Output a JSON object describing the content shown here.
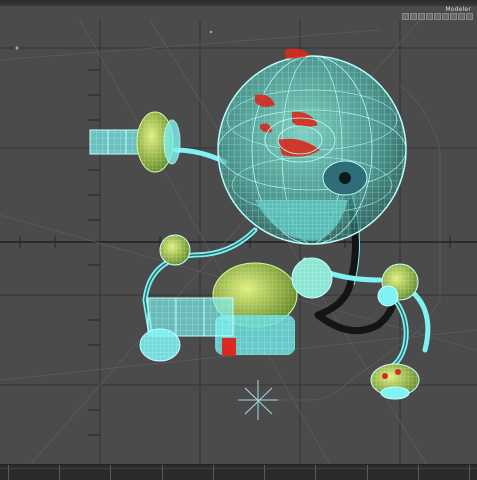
{
  "window": {
    "mode_label": "Modeler"
  },
  "toolbar": {
    "mode_button_count": 9
  },
  "viewport": {
    "background": "#4b4b4b",
    "grid_color": "#2f2f2f",
    "wire_color": "#7ff3f3",
    "accent_green": "#c9e24a",
    "accent_red": "#d82a1e",
    "dark_pipe": "#151515"
  },
  "timeline": {
    "tick_count": 10
  }
}
